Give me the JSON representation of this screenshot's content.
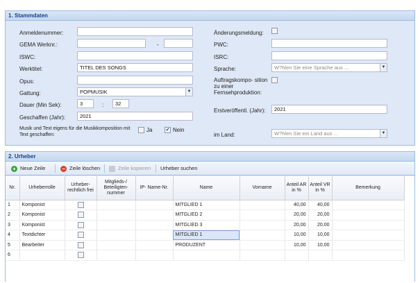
{
  "section1": {
    "title": "1. Stammdaten",
    "anmeldenummer": {
      "label": "Anmeldenummer:",
      "value": ""
    },
    "gema": {
      "label": "GEMA Werknr.:",
      "value1": "",
      "separator": "-",
      "value2": ""
    },
    "iswc": {
      "label": "ISWC:",
      "value": ""
    },
    "werktitel": {
      "label": "Werktitel:",
      "value": "TITEL DES SONGS"
    },
    "opus": {
      "label": "Opus:",
      "value": ""
    },
    "gattung": {
      "label": "Gattung:",
      "value": "POPMUSIK"
    },
    "dauer": {
      "label": "Dauer (Min Sek):",
      "min": "3",
      "separator": ":",
      "sek": "32"
    },
    "geschaffen": {
      "label": "Geschaffen (Jahr):",
      "value": "2021"
    },
    "musik_text": {
      "label": "Musik und Text eigens für die Musikkomposition mit Text geschaffen:",
      "ja": "Ja",
      "ja_checked": false,
      "nein": "Nein",
      "nein_checked": true
    },
    "aenderungsmeldung": {
      "label": "Änderungsmeldung:",
      "checked": false
    },
    "pwc": {
      "label": "PWC:",
      "value": ""
    },
    "isrc": {
      "label": "ISRC:",
      "value": ""
    },
    "sprache": {
      "label": "Sprache:",
      "placeholder": "W?hlen Sie eine Sprache aus ..."
    },
    "auftrag": {
      "label": "Auftragskompo- sition zu einer Fernsehproduktion:",
      "checked": false
    },
    "erstveroeff": {
      "label": "Erstveröffentl. (Jahr):",
      "value": "2021"
    },
    "land": {
      "label": "im Land:",
      "placeholder": "W?hlen Sie ein Land aus ..."
    }
  },
  "section2": {
    "title": "2. Urheber",
    "toolbar": {
      "new_row": "Neue Zeile",
      "delete_row": "Zeile löschen",
      "copy_rows": "Zeile kopieren",
      "search": "Urheber suchen"
    },
    "columns": [
      "Nr.",
      "Urheberrolle",
      "Urheber- rechtlich frei",
      "Mitglieds-/ Beteiligten- nummer",
      "IP- Name-Nr.",
      "Name",
      "Vorname",
      "Anteil AR in %",
      "Anteil VR in %",
      "Bemerkung"
    ],
    "rows": [
      {
        "nr": "1",
        "rolle": "Komponist",
        "frei": false,
        "mitglied": "",
        "ip": "",
        "name": "MITGLIED 1",
        "vorname": "",
        "ar": "40,00",
        "vr": "40,00",
        "bemerkung": ""
      },
      {
        "nr": "2",
        "rolle": "Komponist",
        "frei": false,
        "mitglied": "",
        "ip": "",
        "name": "MITGLIED 2",
        "vorname": "",
        "ar": "20,00",
        "vr": "20,00",
        "bemerkung": ""
      },
      {
        "nr": "3",
        "rolle": "Komponist",
        "frei": false,
        "mitglied": "",
        "ip": "",
        "name": "MITGLIED 3",
        "vorname": "",
        "ar": "20,00",
        "vr": "20,00",
        "bemerkung": ""
      },
      {
        "nr": "4",
        "rolle": "Textdichter",
        "frei": false,
        "mitglied": "",
        "ip": "",
        "name": "MITGLIED 1",
        "vorname": "",
        "ar": "10,00",
        "vr": "10,00",
        "bemerkung": ""
      },
      {
        "nr": "5",
        "rolle": "Bearbeiter",
        "frei": false,
        "mitglied": "",
        "ip": "",
        "name": "PRODUZENT",
        "vorname": "",
        "ar": "10,00",
        "vr": "10,00",
        "bemerkung": ""
      },
      {
        "nr": "6",
        "rolle": "",
        "frei": false,
        "mitglied": "",
        "ip": "",
        "name": "",
        "vorname": "",
        "ar": "",
        "vr": "",
        "bemerkung": ""
      }
    ]
  },
  "colors": {
    "panel_bg": "#dfe8f6",
    "border": "#99bbe8",
    "header_text": "#15428b"
  },
  "icons": {
    "new_row": "plus-icon",
    "delete_row": "minus-icon",
    "copy_rows": "copy-icon",
    "dropdown": "chevron-down-icon"
  }
}
